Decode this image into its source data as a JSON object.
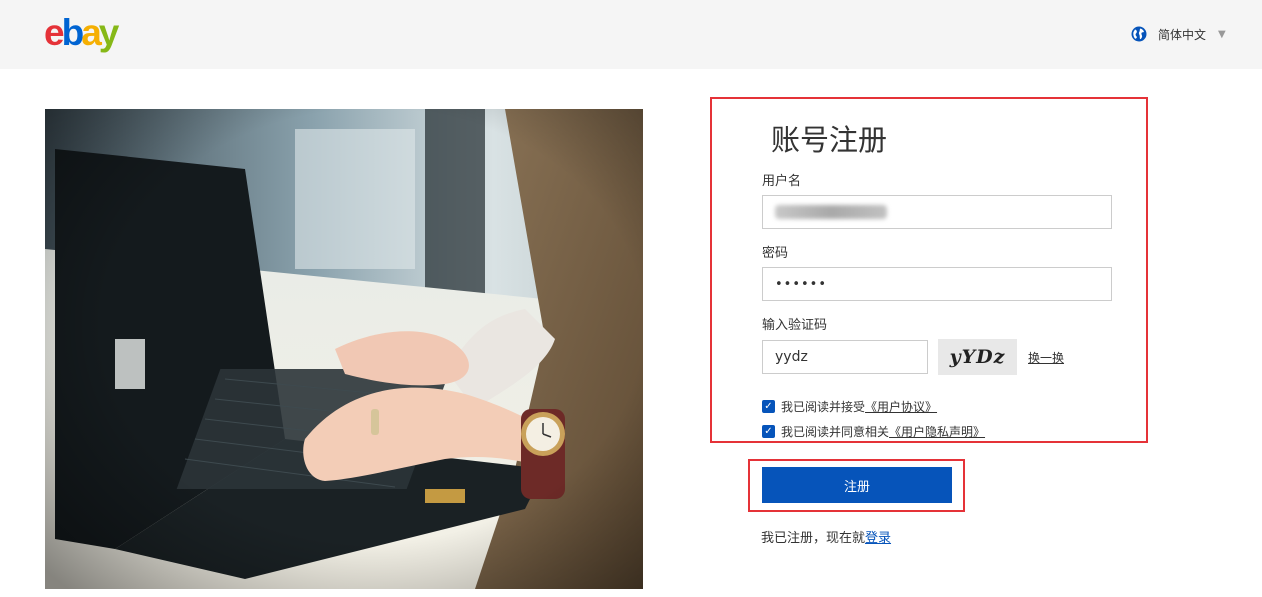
{
  "header": {
    "logo": [
      "e",
      "b",
      "a",
      "y"
    ],
    "language": "简体中文"
  },
  "form": {
    "title": "账号注册",
    "username_label": "用户名",
    "password_label": "密码",
    "password_value": "••••••",
    "captcha_label": "输入验证码",
    "captcha_value": "yydz",
    "captcha_image_text": "yYDz",
    "refresh_link": "换一换",
    "agreement_1_text": "我已阅读并接受",
    "agreement_1_link": "《用户协议》",
    "agreement_2_text": "我已阅读并同意相关",
    "agreement_2_link": "《用户隐私声明》",
    "submit_label": "注册",
    "login_prompt": "我已注册，现在就",
    "login_link": "登录"
  },
  "colors": {
    "accent": "#0654ba",
    "highlight_border": "#e53238",
    "header_bg": "#f5f5f5"
  }
}
